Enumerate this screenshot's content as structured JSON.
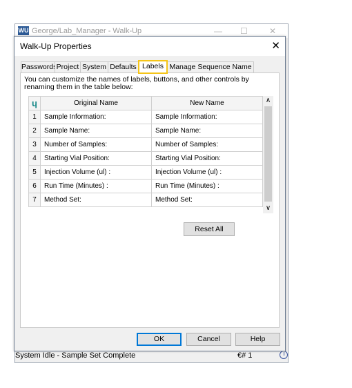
{
  "app_window": {
    "title": "George/Lab_Manager - Walk-Up",
    "icon_text": "WU",
    "status_text": "System Idle - Sample Set Complete",
    "status_right": "€# 1",
    "minimize_glyph": "—",
    "maximize_glyph": "☐",
    "close_glyph": "✕"
  },
  "dialog": {
    "title": "Walk-Up Properties",
    "close_glyph": "✕",
    "tabs": [
      {
        "label": "Passwords"
      },
      {
        "label": "Project"
      },
      {
        "label": "System"
      },
      {
        "label": "Defaults"
      },
      {
        "label": "Labels",
        "active": true
      },
      {
        "label": "Manage Sequence Name"
      }
    ],
    "description": "You can customize the names of labels, buttons, and other controls by renaming them in the table below:",
    "table": {
      "corner_icon": "ɥ",
      "headers": [
        "Original Name",
        "New Name"
      ],
      "rows": [
        {
          "num": "1",
          "original": "Sample Information:",
          "new": "Sample Information:"
        },
        {
          "num": "2",
          "original": "Sample Name:",
          "new": "Sample Name:"
        },
        {
          "num": "3",
          "original": "Number of Samples:",
          "new": "Number of Samples:"
        },
        {
          "num": "4",
          "original": "Starting Vial Position:",
          "new": "Starting Vial Position:"
        },
        {
          "num": "5",
          "original": "Injection Volume (ul) :",
          "new": "Injection Volume (ul) :"
        },
        {
          "num": "6",
          "original": "Run Time (Minutes) :",
          "new": "Run Time (Minutes) :"
        },
        {
          "num": "7",
          "original": "Method Set:",
          "new": "Method Set:"
        }
      ],
      "scroll_up": "∧",
      "scroll_down": "∨"
    },
    "reset_label": "Reset All",
    "buttons": {
      "ok": "OK",
      "cancel": "Cancel",
      "help": "Help"
    },
    "highlight_color": "#f5c518",
    "accent_color": "#0078d7"
  }
}
